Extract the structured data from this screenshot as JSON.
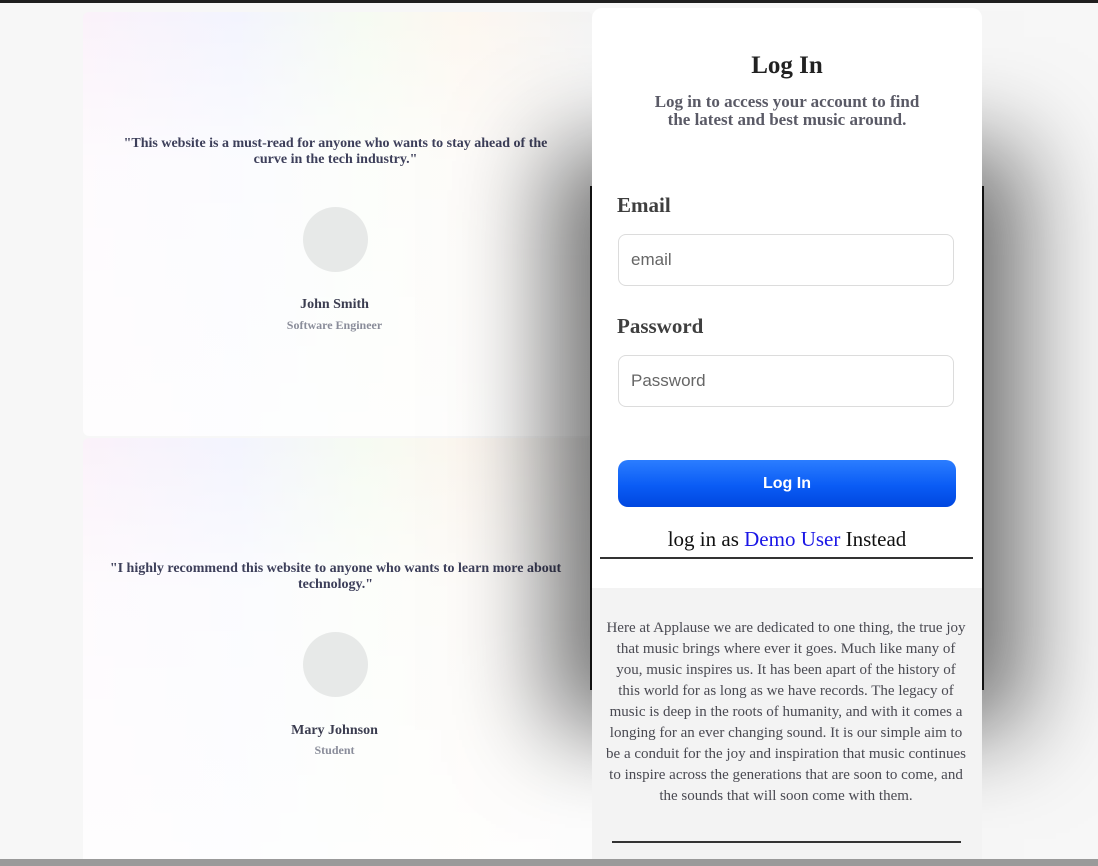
{
  "testimonials": [
    {
      "quote": "\"This website is a must-read for anyone who wants to stay ahead of the curve in the tech industry.\"",
      "name": "John Smith",
      "role": "Software Engineer"
    },
    {
      "quote": "\"I highly recommend this website to anyone who wants to learn more about technology.\"",
      "name": "Mary Johnson",
      "role": "Student"
    }
  ],
  "login": {
    "title": "Log In",
    "subtitle": "Log in to access your account to find the latest and best music around.",
    "email_label": "Email",
    "email_placeholder": "email",
    "password_label": "Password",
    "password_placeholder": "Password",
    "submit_label": "Log In",
    "demo_prefix": "log in as ",
    "demo_link": "Demo User",
    "demo_suffix": " Instead"
  },
  "about": {
    "text": "Here at Applause we are dedicated to one thing, the true joy that music brings where ever it goes. Much like many of you, music inspires us. It has been apart of the history of this world for as long as we have records. The legacy of music is deep in the roots of humanity, and with it comes a longing for an ever changing sound. It is our simple aim to be a conduit for the joy and inspiration that music continues to inspire across the generations that are soon to come, and the sounds that will soon come with them."
  },
  "colors": {
    "button_accent": "#0a5cf5",
    "link": "#1a16e6"
  }
}
